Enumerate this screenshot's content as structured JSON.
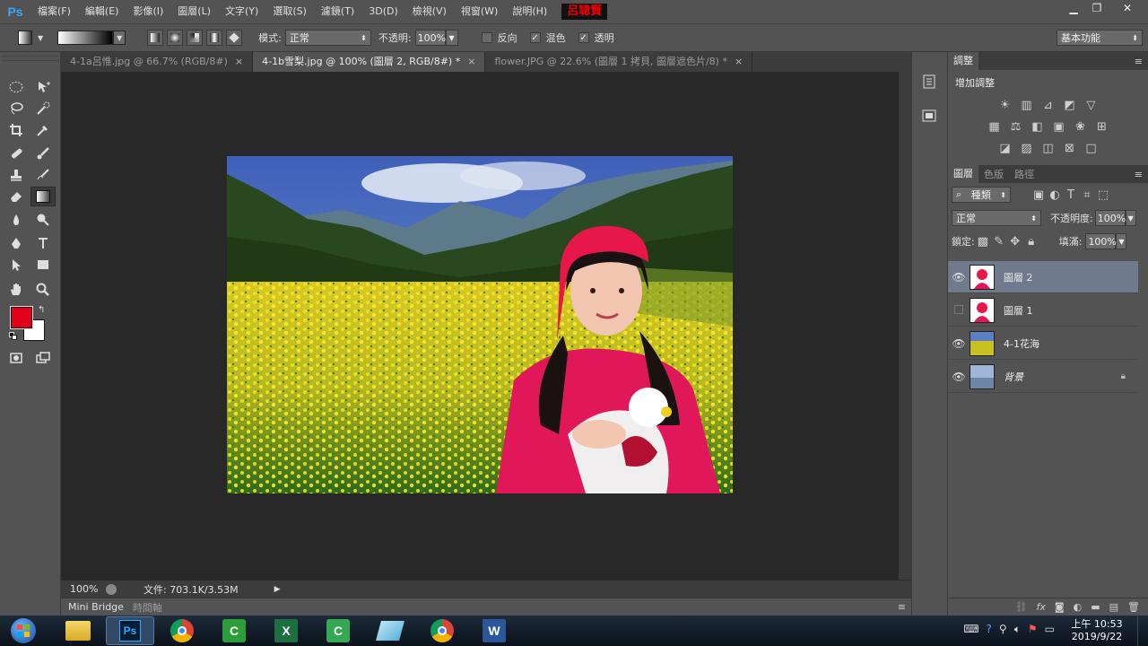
{
  "app": {
    "logo": "Ps",
    "author_tag": "呂聰賢"
  },
  "menu": [
    "檔案(F)",
    "編輯(E)",
    "影像(I)",
    "圖層(L)",
    "文字(Y)",
    "選取(S)",
    "濾鏡(T)",
    "3D(D)",
    "檢視(V)",
    "視窗(W)",
    "說明(H)"
  ],
  "options": {
    "mode_label": "模式:",
    "mode_value": "正常",
    "opacity_label": "不透明:",
    "opacity_value": "100%",
    "reverse_label": "反向",
    "dither_label": "混色",
    "transparency_label": "透明",
    "workspace": "基本功能"
  },
  "tabs": [
    {
      "label": "4-1a呂惟.jpg @ 66.7% (RGB/8#)",
      "close": "×"
    },
    {
      "label": "4-1b雪梨.jpg @ 100% (圖層 2, RGB/8#) *",
      "close": "×"
    },
    {
      "label": "flower.JPG @ 22.6% (圖層 1 拷貝, 圖層遮色片/8) *",
      "close": "×"
    }
  ],
  "status": {
    "zoom": "100%",
    "doc_info": "文件: 703.1K/3.53M"
  },
  "mini": {
    "bridge": "Mini Bridge",
    "timeline": "時間軸"
  },
  "adjust": {
    "tab": "調整",
    "heading": "增加調整"
  },
  "layers_panel": {
    "tabs": [
      "圖層",
      "色版",
      "路徑"
    ],
    "filter_kind": "種類",
    "blend_mode": "正常",
    "opacity_label": "不透明度:",
    "opacity_value": "100%",
    "lock_label": "鎖定:",
    "fill_label": "填滿:",
    "fill_value": "100%",
    "layers": [
      {
        "name": "圖層 2",
        "visible": true,
        "selected": true
      },
      {
        "name": "圖層 1",
        "visible": false,
        "selected": false
      },
      {
        "name": "4-1花海",
        "visible": true,
        "selected": false
      },
      {
        "name": "背景",
        "visible": true,
        "selected": false
      }
    ]
  },
  "colors": {
    "foreground": "#e3001b",
    "background": "#ffffff",
    "selected_layer": "#6f7b8c"
  },
  "taskbar": {
    "clock_time": "上午 10:53",
    "clock_date": "2019/9/22"
  }
}
